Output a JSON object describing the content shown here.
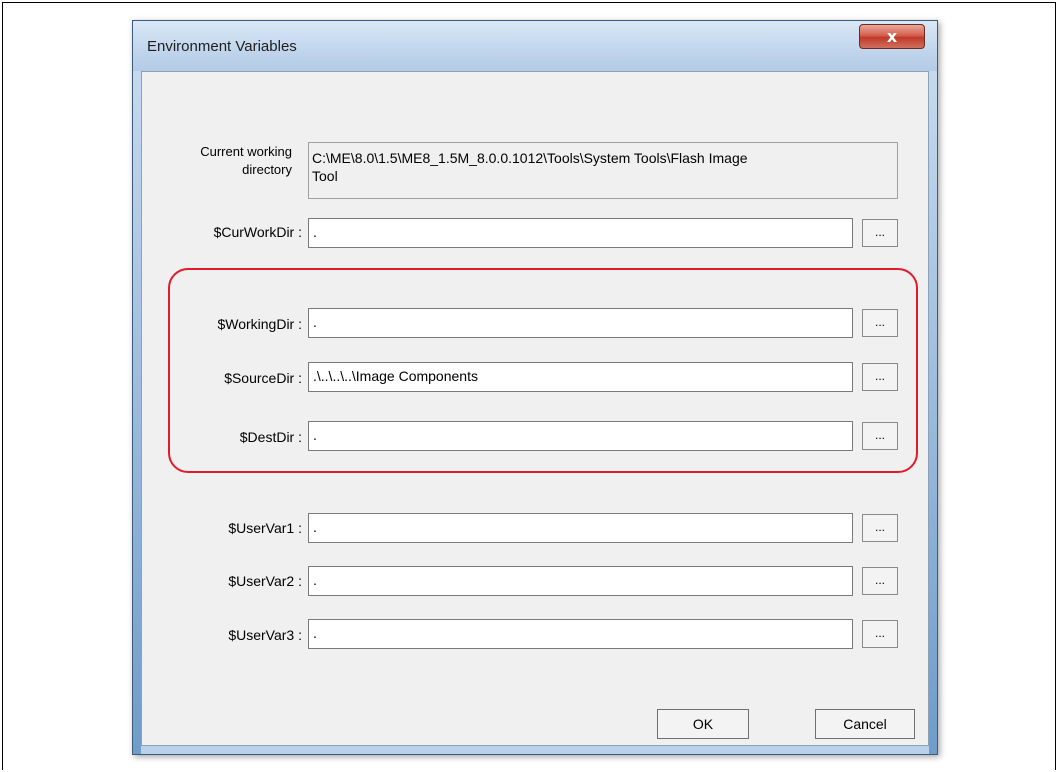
{
  "window": {
    "title": "Environment Variables",
    "close_glyph": "x"
  },
  "cwd": {
    "label_line1": "Current working",
    "label_line2": "directory",
    "value_line1": "C:\\ME\\8.0\\1.5\\ME8_1.5M_8.0.0.1012\\Tools\\System Tools\\Flash Image",
    "value_line2": "Tool"
  },
  "fields": [
    {
      "label": "$CurWorkDir :",
      "value": "."
    },
    {
      "label": "$WorkingDir :",
      "value": "."
    },
    {
      "label": "$SourceDir :",
      "value": ".\\..\\..\\..\\Image Components"
    },
    {
      "label": "$DestDir :",
      "value": "."
    },
    {
      "label": "$UserVar1 :",
      "value": "."
    },
    {
      "label": "$UserVar2 :",
      "value": "."
    },
    {
      "label": "$UserVar3 :",
      "value": "."
    }
  ],
  "browse_label": "...",
  "buttons": {
    "ok": "OK",
    "cancel": "Cancel"
  },
  "colors": {
    "highlight": "#e01c2b",
    "close_button": "#c0392b"
  }
}
